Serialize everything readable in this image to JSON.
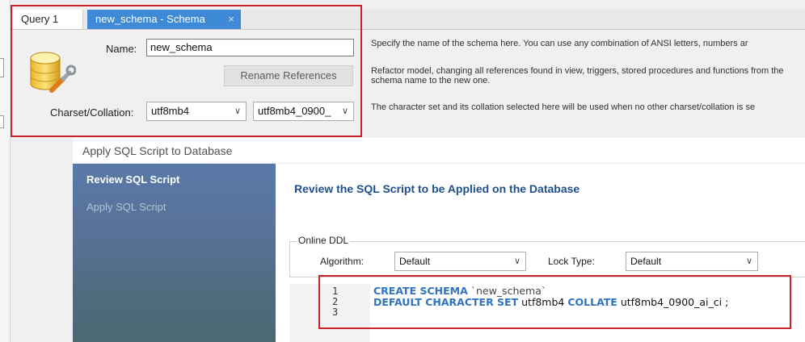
{
  "tabs": [
    {
      "label": "Query 1"
    },
    {
      "label": "new_schema - Schema",
      "close": "×"
    }
  ],
  "editor": {
    "name_label": "Name:",
    "name_value": "new_schema",
    "rename_button": "Rename References",
    "charset_label": "Charset/Collation:",
    "charset_value": "utf8mb4",
    "collation_value": "utf8mb4_0900_",
    "chevron": "∨",
    "help": {
      "name": "Specify the name of the schema here. You can use any combination of ANSI letters, numbers ar",
      "rename_line1": "Refactor model, changing all references found in view, triggers, stored procedures and functions from the",
      "rename_line2": "schema name to the new one.",
      "charset": "The character set and its collation selected here will be used when no other charset/collation is se"
    }
  },
  "dialog": {
    "title": "Apply SQL Script to Database",
    "steps": [
      "Review SQL Script",
      "Apply SQL Script"
    ],
    "heading": "Review the SQL Script to be Applied on the Database",
    "online_ddl": {
      "legend": "Online DDL",
      "algorithm_label": "Algorithm:",
      "algorithm_value": "Default",
      "lock_label": "Lock Type:",
      "lock_value": "Default"
    },
    "script": {
      "line_numbers": [
        "1",
        "2",
        "3"
      ],
      "line1_kw": "CREATE SCHEMA",
      "line1_rest": " `new_schema`",
      "line2_kw1": "DEFAULT CHARACTER SET",
      "line2_mid": " utf8mb4 ",
      "line2_kw2": "COLLATE",
      "line2_rest": " utf8mb4_0900_ai_ci ;"
    }
  },
  "colors": {
    "tab_active": "#3e8ad7",
    "highlight_box": "#c8242b",
    "heading": "#1e4f8d",
    "sql_keyword": "#2f73c2"
  },
  "icons": {
    "schema": "database-wrench-icon",
    "chevron": "chevron-down-icon",
    "close": "close-icon"
  }
}
